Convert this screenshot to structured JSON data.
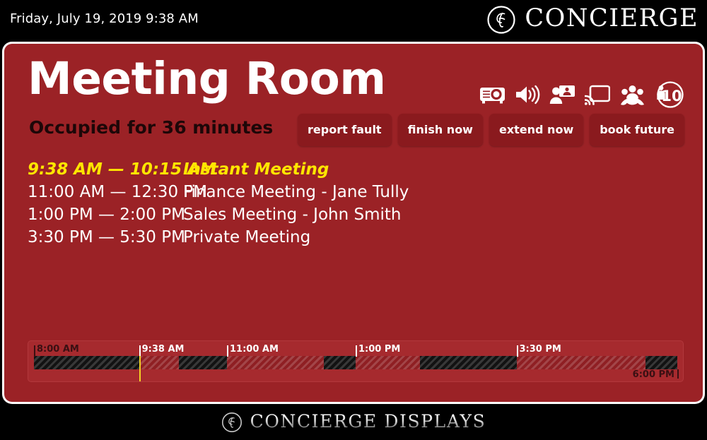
{
  "header": {
    "datetime": "Friday, July 19, 2019 9:38 AM",
    "brand": "CONCIERGE",
    "brand_icon": "concierge-monogram-icon"
  },
  "room": {
    "name": "Meeting Room",
    "status": "Occupied for 36 minutes",
    "panel_color": "#9b2226",
    "status_color": "#1d0708"
  },
  "facilities": [
    {
      "name": "projector-icon",
      "label": "projector"
    },
    {
      "name": "speaker-icon",
      "label": "audio"
    },
    {
      "name": "video-conference-icon",
      "label": "video conferencing"
    },
    {
      "name": "screen-cast-icon",
      "label": "screen casting"
    },
    {
      "name": "conference-call-icon",
      "label": "conference call"
    }
  ],
  "capacity": {
    "name": "capacity-badge",
    "value": "10"
  },
  "actions": [
    {
      "name": "report-fault-button",
      "label": "report fault"
    },
    {
      "name": "finish-now-button",
      "label": "finish now"
    },
    {
      "name": "extend-now-button",
      "label": "extend now"
    },
    {
      "name": "book-future-button",
      "label": "book future"
    }
  ],
  "bookings": [
    {
      "time": "9:38 AM — 10:15 AM",
      "title": "Instant Meeting",
      "current": true
    },
    {
      "time": "11:00 AM — 12:30 PM",
      "title": "Finance Meeting - Jane Tully",
      "current": false
    },
    {
      "time": "1:00 PM — 2:00 PM",
      "title": "Sales Meeting - John Smith",
      "current": false
    },
    {
      "time": "3:30 PM — 5:30 PM",
      "title": "Private Meeting",
      "current": false
    }
  ],
  "timeline": {
    "start_label": "8:00 AM",
    "end_label": "6:00 PM",
    "now_label": "9:38 AM",
    "now_color": "#f2d024",
    "ticks": [
      {
        "label": "8:00 AM",
        "pos": 0.0,
        "dim": true
      },
      {
        "label": "9:38 AM",
        "pos": 0.1633,
        "dim": false
      },
      {
        "label": "11:00 AM",
        "pos": 0.3,
        "dim": false
      },
      {
        "label": "1:00 PM",
        "pos": 0.5,
        "dim": false
      },
      {
        "label": "3:30 PM",
        "pos": 0.75,
        "dim": false
      }
    ],
    "segments": [
      {
        "kind": "free",
        "start": 0.0,
        "end": 0.1633
      },
      {
        "kind": "busy",
        "start": 0.1633,
        "end": 0.225
      },
      {
        "kind": "free",
        "start": 0.225,
        "end": 0.3
      },
      {
        "kind": "busy",
        "start": 0.3,
        "end": 0.45
      },
      {
        "kind": "free",
        "start": 0.45,
        "end": 0.5
      },
      {
        "kind": "busy",
        "start": 0.5,
        "end": 0.6
      },
      {
        "kind": "free",
        "start": 0.6,
        "end": 0.75
      },
      {
        "kind": "busy",
        "start": 0.75,
        "end": 0.95
      },
      {
        "kind": "free",
        "start": 0.95,
        "end": 1.0
      }
    ],
    "now_pos": 0.1633
  },
  "footer": {
    "brand": "CONCIERGE  DISPLAYS",
    "brand_icon": "concierge-monogram-icon"
  }
}
